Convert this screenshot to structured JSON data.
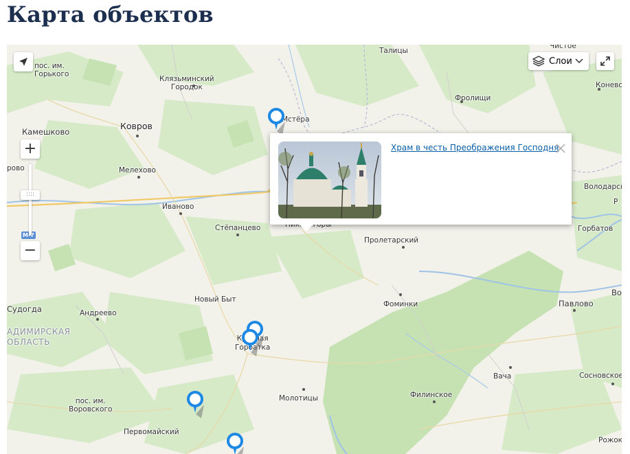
{
  "page": {
    "title": "Карта объектов"
  },
  "controls": {
    "zoom_in": "+",
    "zoom_out": "−",
    "layers_label": "Слои",
    "zoom_handle_grip": "::::"
  },
  "road_badge": "М-7",
  "popup": {
    "link_text": "Храм в честь Преображения Господня"
  },
  "region_label": "АДИМИРСКАЯ\nОБЛАСТЬ",
  "places": {
    "pos_gorkogo": "пос. им.\nГорького",
    "klyazminsky": "Клязьминский\nГородок",
    "talitsy": "Талицы",
    "chistoe": "Чистое",
    "konevo": "Конево",
    "frolishchi": "Фролищи",
    "kameshkovo": "Камешково",
    "kovrov": "Ковров",
    "mstera": "Мстёра",
    "rovo": "рово",
    "melekhovo": "Мелехово",
    "volodarsk": "Володарск",
    "r_edge": "Р",
    "ivanovo": "Иваново",
    "stepantsevo": "Стёпанцево",
    "nikologory": "Никологоры",
    "gorbatov": "Горбатов",
    "proletarsky": "Пролетарский",
    "noviy_byt": "Новый Быт",
    "fominki": "Фоминки",
    "pavlovo": "Павлово",
    "vo_edge": "Во",
    "sudogda": "Судогда",
    "andreevo": "Андреево",
    "krasnaya_gorbatka": "Красная\nГорбатка",
    "vacha": "Вача",
    "sosnovskoe": "Сосновское",
    "filinskoe": "Филинское",
    "molotitsy": "Молотицы",
    "pos_vorovskogo": "пос. им.\nВоровского",
    "pervomaisky": "Первомайский",
    "rozhok": "Рожок"
  },
  "icons": [
    "locate-arrow-icon",
    "plus-icon",
    "minus-icon",
    "layers-icon",
    "chevron-down-icon",
    "fullscreen-icon",
    "close-icon",
    "map-marker-icon"
  ],
  "colors": {
    "title": "#1c2f4f",
    "marker": "#1e88e5",
    "link": "#0a5fa8",
    "river": "#9fc3e6",
    "forest": "#cfe6bf",
    "road": "#f2c96a"
  }
}
